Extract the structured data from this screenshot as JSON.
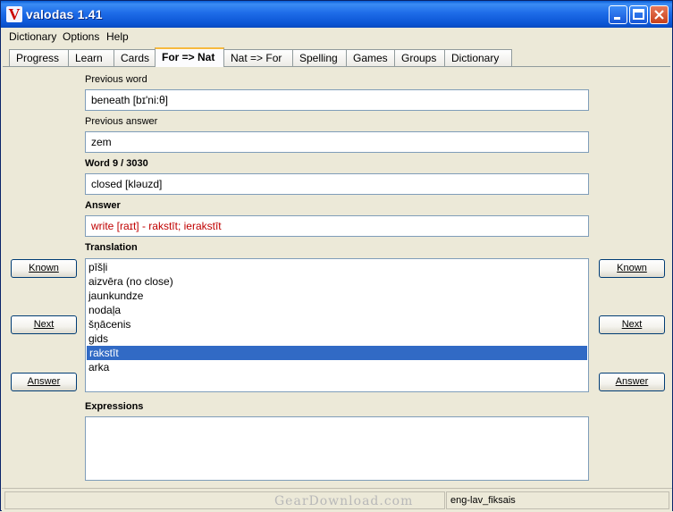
{
  "window": {
    "title": "valodas 1.41",
    "icon_letter": "V",
    "controls": [
      "minimize",
      "maximize",
      "close"
    ]
  },
  "menu": [
    "Dictionary",
    "Options",
    "Help"
  ],
  "tabs": [
    {
      "label": "Progress"
    },
    {
      "label": "Learn"
    },
    {
      "label": "Cards"
    },
    {
      "label": "For => Nat",
      "active": true
    },
    {
      "label": "Nat => For"
    },
    {
      "label": "Spelling"
    },
    {
      "label": "Games"
    },
    {
      "label": "Groups"
    },
    {
      "label": "Dictionary"
    }
  ],
  "form": {
    "previous_word_label": "Previous word",
    "previous_word_value": "beneath [bɪ'ni:θ]",
    "previous_answer_label": "Previous answer",
    "previous_answer_value": "zem",
    "word_label": "Word 9 / 3030",
    "word_value": "closed [kləuzd]",
    "answer_label": "Answer",
    "answer_value": "write [raɪt] - rakstīt; ierakstīt",
    "translation_label": "Translation",
    "translation_items": [
      "pīšļi",
      "aizvēra (no close)",
      "jaunkundze",
      "nodaļa",
      "šņācenis",
      "gids",
      "rakstīt",
      "arka"
    ],
    "selected_translation": "rakstīt",
    "expressions_label": "Expressions",
    "expressions_value": ""
  },
  "buttons": {
    "known": "Known",
    "next": "Next",
    "answer": "Answer"
  },
  "status": {
    "dictionary": "eng-lav_fiksais"
  },
  "watermark": "GearDownload.com",
  "colors": {
    "answer_text": "#c00000",
    "selection": "#316ac5",
    "titlebar": "#0a5fd8",
    "active_tab_accent": "#f7b93d"
  }
}
